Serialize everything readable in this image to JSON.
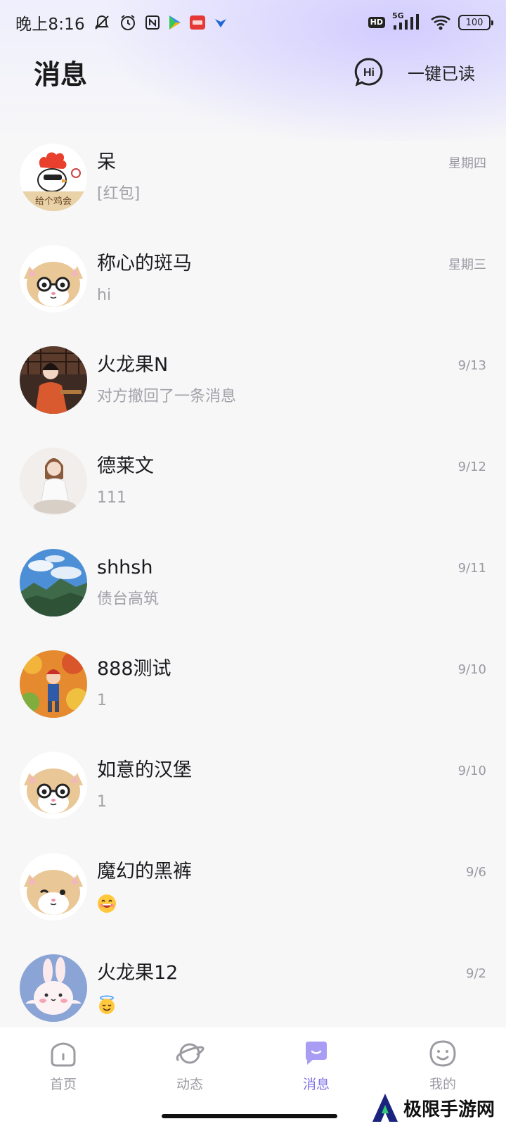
{
  "status_bar": {
    "time": "晚上8:16",
    "network_badge": "HD",
    "network_type": "5G",
    "battery": "100"
  },
  "header": {
    "title": "消息",
    "hi_icon": "hi-bubble-icon",
    "read_all": "一键已读"
  },
  "conversations": [
    {
      "name": "呆",
      "message": "[红包]",
      "time": "星期四",
      "avatar": "rooster-cartoon"
    },
    {
      "name": "称心的斑马",
      "message": "hi",
      "time": "星期三",
      "avatar": "hamster-glasses"
    },
    {
      "name": "火龙果N",
      "message": "对方撤回了一条消息",
      "time": "9/13",
      "avatar": "photo-woman-red"
    },
    {
      "name": "德莱文",
      "message": "111",
      "time": "9/12",
      "avatar": "photo-woman-white"
    },
    {
      "name": "shhsh",
      "message": "债台高筑",
      "time": "9/11",
      "avatar": "photo-mountains"
    },
    {
      "name": "888测试",
      "message": "1",
      "time": "9/10",
      "avatar": "photo-autumn-cartoon"
    },
    {
      "name": "如意的汉堡",
      "message": "1",
      "time": "9/10",
      "avatar": "hamster-glasses"
    },
    {
      "name": "魔幻的黑裤",
      "message": "",
      "message_emoji": "grinning-face",
      "time": "9/6",
      "avatar": "hamster-wink"
    },
    {
      "name": "火龙果12",
      "message": "",
      "message_emoji": "angel-face",
      "time": "9/2",
      "avatar": "rabbit-cartoon"
    }
  ],
  "tabs": [
    {
      "label": "首页",
      "icon": "home-icon",
      "active": false
    },
    {
      "label": "动态",
      "icon": "planet-icon",
      "active": false
    },
    {
      "label": "消息",
      "icon": "message-icon",
      "active": true
    },
    {
      "label": "我的",
      "icon": "smiley-profile-icon",
      "active": false
    }
  ],
  "colors": {
    "accent": "#7f72e8",
    "tab_inactive": "#9b9ba2",
    "time_text": "#9a9aa2",
    "background": "#f7f7f8"
  },
  "watermark": {
    "text": "极限手游网"
  }
}
